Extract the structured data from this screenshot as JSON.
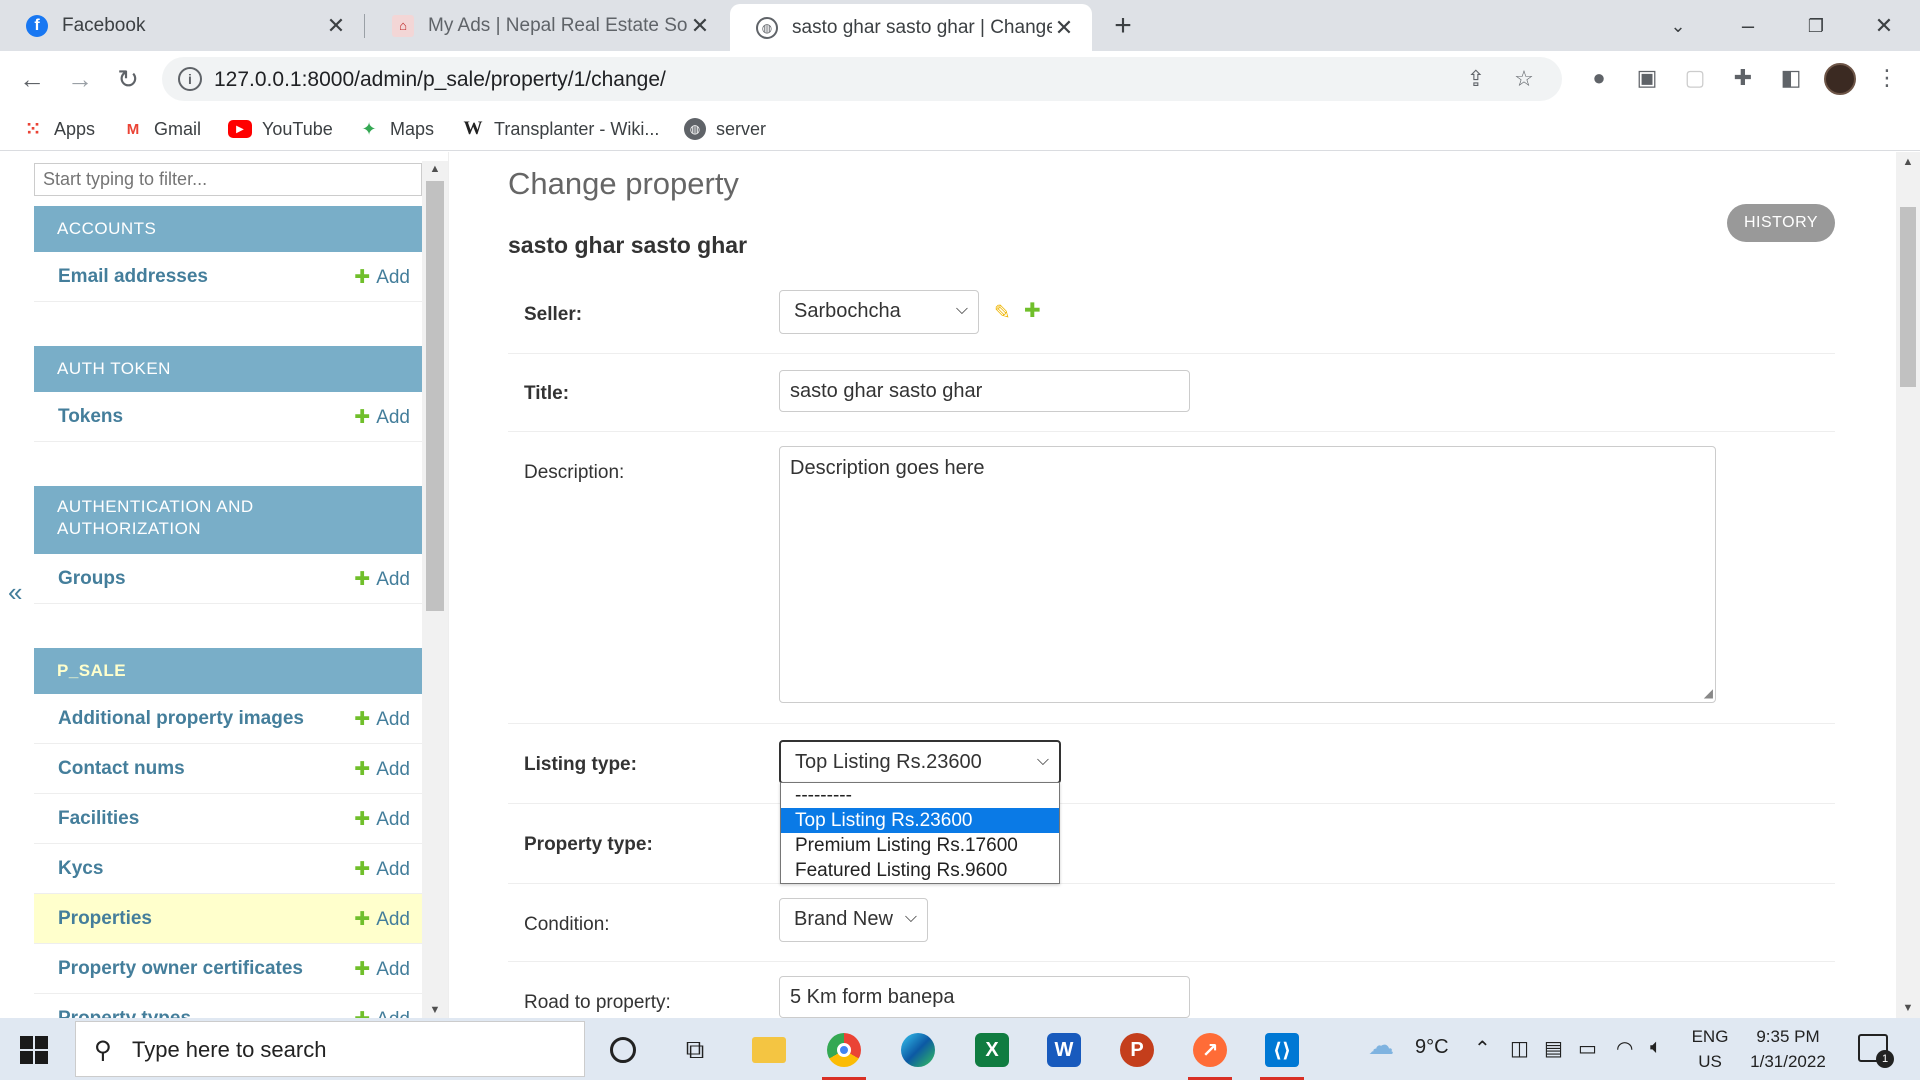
{
  "browser": {
    "tabs": [
      {
        "title": "Facebook",
        "icon": "facebook-icon"
      },
      {
        "title": "My Ads | Nepal Real Estate Soluti",
        "icon": "real-estate-logo-icon"
      },
      {
        "title": "sasto ghar sasto ghar | Change p",
        "icon": "globe-icon"
      }
    ],
    "url": "127.0.0.1:8000/admin/p_sale/property/1/change/",
    "bookmarks": [
      {
        "label": "Apps",
        "icon": "apps-grid-icon"
      },
      {
        "label": "Gmail",
        "icon": "gmail-icon"
      },
      {
        "label": "YouTube",
        "icon": "youtube-icon"
      },
      {
        "label": "Maps",
        "icon": "maps-icon"
      },
      {
        "label": "Transplanter - Wiki...",
        "icon": "wikipedia-icon"
      },
      {
        "label": "server",
        "icon": "globe-icon"
      }
    ]
  },
  "sidebar": {
    "filter_placeholder": "Start typing to filter...",
    "add_label": "Add",
    "modules": [
      {
        "name": "ACCOUNTS",
        "items": [
          "Email addresses"
        ]
      },
      {
        "name": "AUTH TOKEN",
        "items": [
          "Tokens"
        ]
      },
      {
        "name": "AUTHENTICATION AND AUTHORIZATION",
        "items": [
          "Groups"
        ]
      },
      {
        "name": "P_SALE",
        "items": [
          "Additional property images",
          "Contact nums",
          "Facilities",
          "Kycs",
          "Properties",
          "Property owner certificates",
          "Property types"
        ]
      }
    ],
    "current_item": "Properties",
    "toggle_glyph": "«"
  },
  "main": {
    "page_title": "Change property",
    "object_title": "sasto ghar sasto ghar",
    "history_label": "HISTORY",
    "fields": {
      "seller": {
        "label": "Seller:",
        "value": "Sarbochcha"
      },
      "title": {
        "label": "Title:",
        "value": "sasto ghar sasto ghar"
      },
      "description": {
        "label": "Description:",
        "value": "Description goes here"
      },
      "listing_type": {
        "label": "Listing type:",
        "value": "Top Listing Rs.23600",
        "options": [
          "---------",
          "Top Listing Rs.23600",
          "Premium Listing Rs.17600",
          "Featured Listing Rs.9600"
        ]
      },
      "property_type": {
        "label": "Property type:"
      },
      "condition": {
        "label": "Condition:",
        "value": "Brand New"
      },
      "road": {
        "label": "Road to property:",
        "value": "5 Km form banepa"
      }
    }
  },
  "taskbar": {
    "search_placeholder": "Type here to search",
    "weather": "9°C",
    "lang_top": "ENG",
    "lang_bottom": "US",
    "time": "9:35 PM",
    "date": "1/31/2022",
    "notifications": "1"
  },
  "colors": {
    "module_header": "#79aec8",
    "link": "#447e9b",
    "add_plus": "#70bf2b",
    "current_row": "#ffffcc",
    "selected_option": "#0a7ae6"
  }
}
